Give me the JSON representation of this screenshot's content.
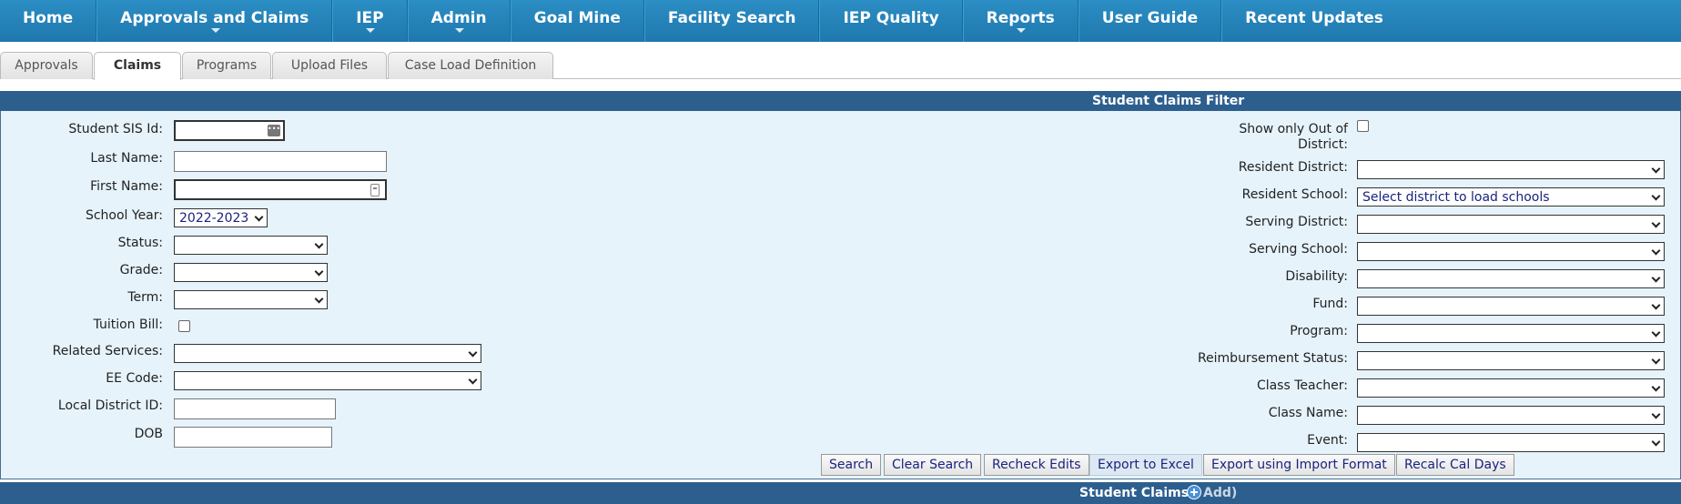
{
  "nav": {
    "items": [
      {
        "label": "Home"
      },
      {
        "label": "Approvals and Claims"
      },
      {
        "label": "IEP"
      },
      {
        "label": "Admin"
      },
      {
        "label": "Goal Mine"
      },
      {
        "label": "Facility Search"
      },
      {
        "label": "IEP Quality"
      },
      {
        "label": "Reports"
      },
      {
        "label": "User Guide"
      },
      {
        "label": "Recent Updates"
      }
    ]
  },
  "tabs": [
    {
      "label": "Approvals"
    },
    {
      "label": "Claims",
      "active": true
    },
    {
      "label": "Programs"
    },
    {
      "label": "Upload Files"
    },
    {
      "label": "Case Load Definition"
    }
  ],
  "filter": {
    "title": "Student Claims Filter",
    "left": {
      "student_sis_id_label": "Student SIS Id:",
      "last_name_label": "Last Name:",
      "first_name_label": "First Name:",
      "school_year_label": "School Year:",
      "school_year_value": "2022-2023",
      "status_label": "Status:",
      "grade_label": "Grade:",
      "term_label": "Term:",
      "tuition_bill_label": "Tuition Bill:",
      "related_services_label": "Related Services:",
      "ee_code_label": "EE Code:",
      "local_district_id_label": "Local District ID:",
      "dob_label": "DOB"
    },
    "right": {
      "out_of_district_label_1": "Show only Out of",
      "out_of_district_label_2": "District:",
      "resident_district_label": "Resident District:",
      "resident_school_label": "Resident School:",
      "resident_school_value": "Select district to load schools",
      "serving_district_label": "Serving District:",
      "serving_school_label": "Serving School:",
      "disability_label": "Disability:",
      "fund_label": "Fund:",
      "program_label": "Program:",
      "reimbursement_status_label": "Reimbursement Status:",
      "class_teacher_label": "Class Teacher:",
      "class_name_label": "Class Name:",
      "event_label": "Event:"
    },
    "buttons": {
      "search": "Search",
      "clear_search": "Clear Search",
      "recheck_edits": "Recheck Edits",
      "export_excel": "Export to Excel",
      "export_import": "Export using Import Format",
      "recalc": "Recalc Cal Days"
    }
  },
  "claims": {
    "title": "Student Claims (",
    "add_label": "Add)"
  }
}
